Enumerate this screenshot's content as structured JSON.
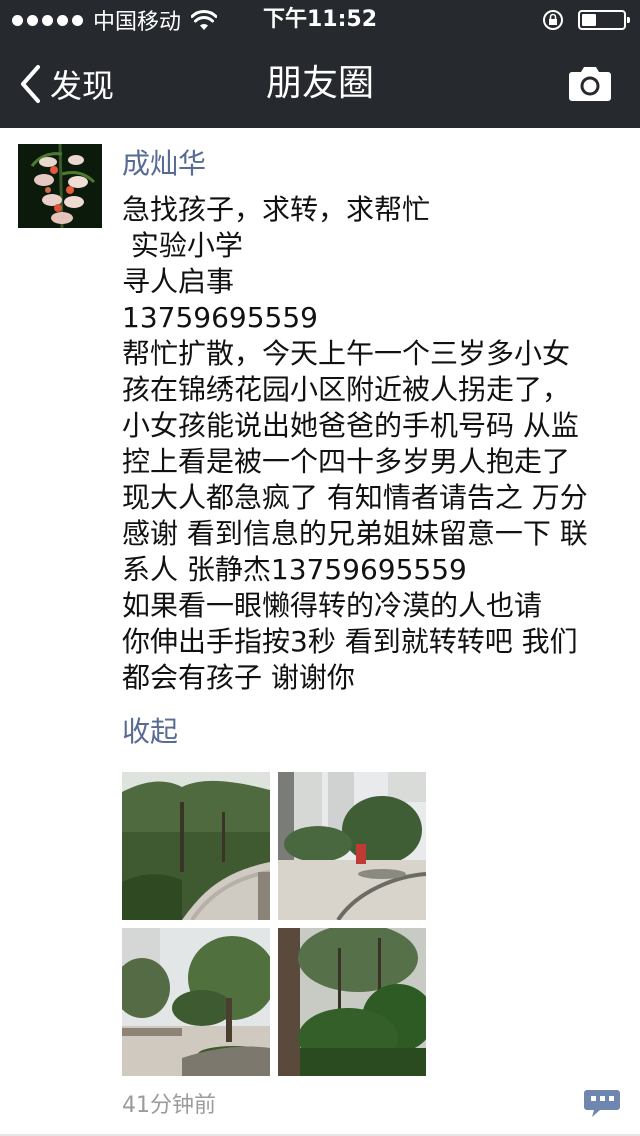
{
  "status_bar": {
    "carrier": "中国移动",
    "time": "下午11:52",
    "battery_level": 0.35
  },
  "nav": {
    "back_label": "发现",
    "title": "朋友圈"
  },
  "post": {
    "author": "成灿华",
    "lines": [
      "急找孩子，求转，求帮忙",
      " 实验小学",
      "寻人启事",
      "13759695559",
      "帮忙扩散，今天上午一个三岁多小女",
      "孩在锦绣花园小区附近被人拐走了，",
      "小女孩能说出她爸爸的手机号码 从监",
      "控上看是被一个四十多岁男人抱走了",
      "现大人都急疯了 有知情者请告之 万分",
      "感谢 看到信息的兄弟姐妹留意一下 联",
      "系人 张静杰13759695559",
      "如果看一眼懒得转的冷漠的人也请",
      "你伸出手指按3秒 看到就转转吧 我们",
      "都会有孩子 谢谢你"
    ],
    "collapse_label": "收起",
    "timestamp": "41分钟前"
  },
  "colors": {
    "nav_background": "#262a2f",
    "link_blue": "#576b95",
    "timestamp_gray": "#9b9b9b"
  },
  "icons": {
    "back": "chevron-left-icon",
    "camera": "camera-icon",
    "wifi": "wifi-icon",
    "lock": "rotation-lock-icon",
    "comment": "comment-icon"
  }
}
